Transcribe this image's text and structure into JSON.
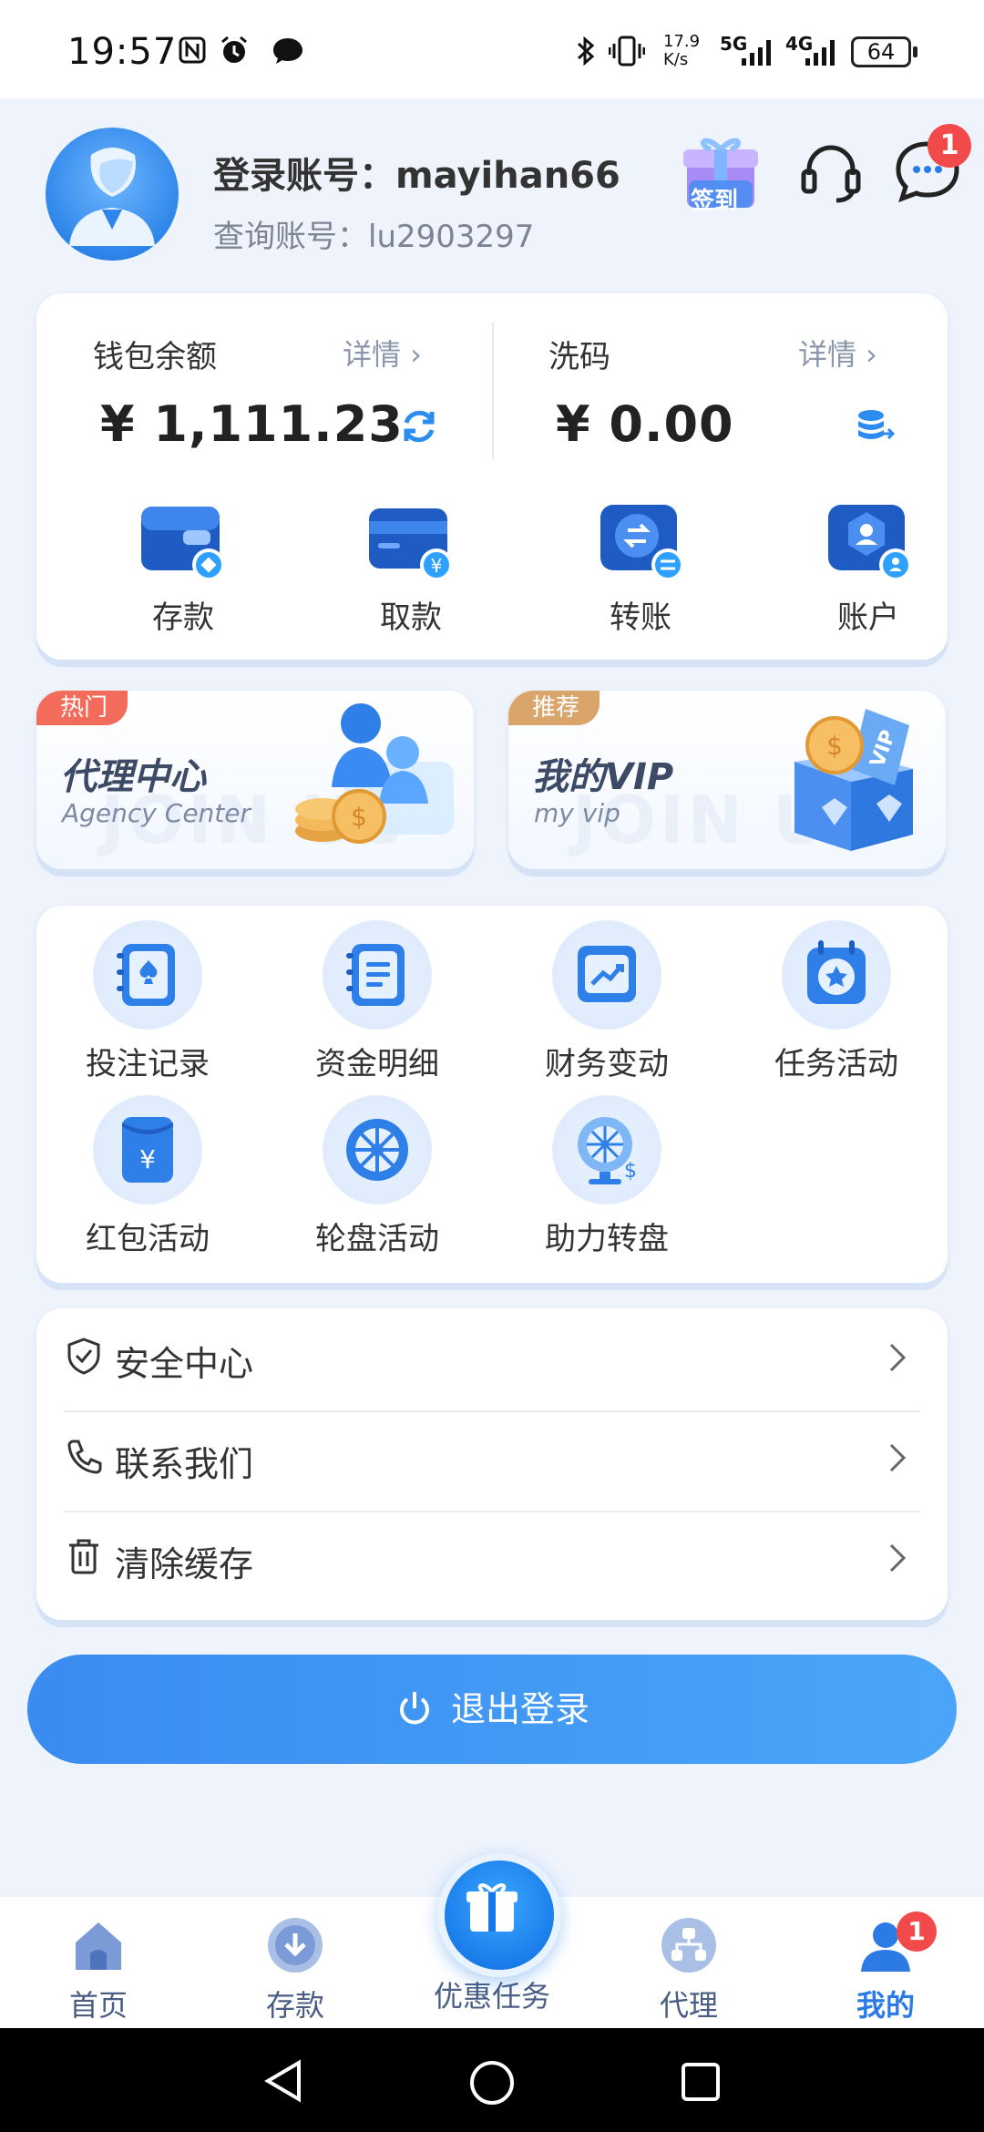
{
  "status_bar": {
    "time": "19:57",
    "net_speed_top": "17.9",
    "net_speed_bottom": "K/s",
    "signal1": "5G",
    "signal2": "4G",
    "battery": "64"
  },
  "header": {
    "login_account": "登录账号：mayihan66",
    "query_account": "查询账号：lu2903297",
    "checkin_label": "签到",
    "message_badge": "1"
  },
  "wallet": {
    "balance_title": "钱包余额",
    "balance_detail": "详情 ›",
    "balance_amount": "¥ 1,111.23",
    "wash_title": "洗码",
    "wash_detail": "详情 ›",
    "wash_amount": "¥ 0.00",
    "actions": [
      {
        "label": "存款",
        "icon": "deposit-wallet-icon"
      },
      {
        "label": "取款",
        "icon": "withdraw-card-icon"
      },
      {
        "label": "转账",
        "icon": "transfer-icon"
      },
      {
        "label": "账户",
        "icon": "account-icon"
      }
    ]
  },
  "promos": [
    {
      "tag": "热门",
      "title": "代理中心",
      "subtitle": "Agency Center",
      "tag_color": "#f26b5b"
    },
    {
      "tag": "推荐",
      "title": "我的VIP",
      "subtitle": "my vip",
      "tag_color": "#d9a56a"
    }
  ],
  "grid": [
    {
      "label": "投注记录",
      "icon": "bet-record-icon"
    },
    {
      "label": "资金明细",
      "icon": "fund-detail-icon"
    },
    {
      "label": "财务变动",
      "icon": "finance-change-icon"
    },
    {
      "label": "任务活动",
      "icon": "task-activity-icon"
    },
    {
      "label": "红包活动",
      "icon": "red-packet-icon"
    },
    {
      "label": "轮盘活动",
      "icon": "roulette-icon"
    },
    {
      "label": "助力转盘",
      "icon": "lucky-wheel-icon"
    }
  ],
  "list": [
    {
      "label": "安全中心",
      "icon": "shield-icon"
    },
    {
      "label": "联系我们",
      "icon": "phone-icon"
    },
    {
      "label": "清除缓存",
      "icon": "trash-icon"
    }
  ],
  "logout_label": "退出登录",
  "tabs": [
    {
      "label": "首页",
      "icon": "home-icon"
    },
    {
      "label": "存款",
      "icon": "deposit-icon"
    },
    {
      "label": "优惠任务",
      "icon": "gift-icon"
    },
    {
      "label": "代理",
      "icon": "agent-icon"
    },
    {
      "label": "我的",
      "icon": "profile-icon"
    }
  ],
  "tab_badge": "1",
  "colors": {
    "accent": "#2c7be5",
    "badge": "#f24a4a"
  }
}
